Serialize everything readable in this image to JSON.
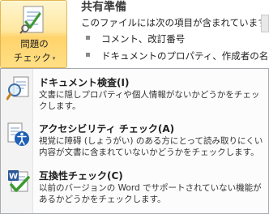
{
  "ribbon_button": {
    "label_line1": "問題の",
    "label_line2": "チェック",
    "caret": "▾",
    "icon": "document-check-icon"
  },
  "section": {
    "title": "共有準備",
    "description": "このファイルには次の項目が含まれています。ファ",
    "bullets": [
      "コメント、改訂番号",
      "ドキュメントのプロパティ、作成者の名前"
    ]
  },
  "menu": {
    "items": [
      {
        "title": "ドキュメント検査(I)",
        "description": "文書に隠しプロパティや個人情報がないかどうかをチェックします。",
        "icon": "inspect-document-icon"
      },
      {
        "title": "アクセシビリティ チェック(A)",
        "description": "視覚に障碍 (しょうがい) のある方にとって読み取りにくい内容が文書に含まれていないかどうかをチェックします。",
        "icon": "accessibility-icon"
      },
      {
        "title": "互換性チェック(C)",
        "description": "以前のバージョンの Word でサポートされていない機能があるかどうかをチェックします。",
        "icon": "word-compatibility-icon"
      }
    ]
  },
  "colors": {
    "ribbon_active_top": "#fff6cf",
    "ribbon_active_bottom": "#ffd36b",
    "menu_border": "#a7abb0",
    "title_text": "#3b3b3b"
  }
}
